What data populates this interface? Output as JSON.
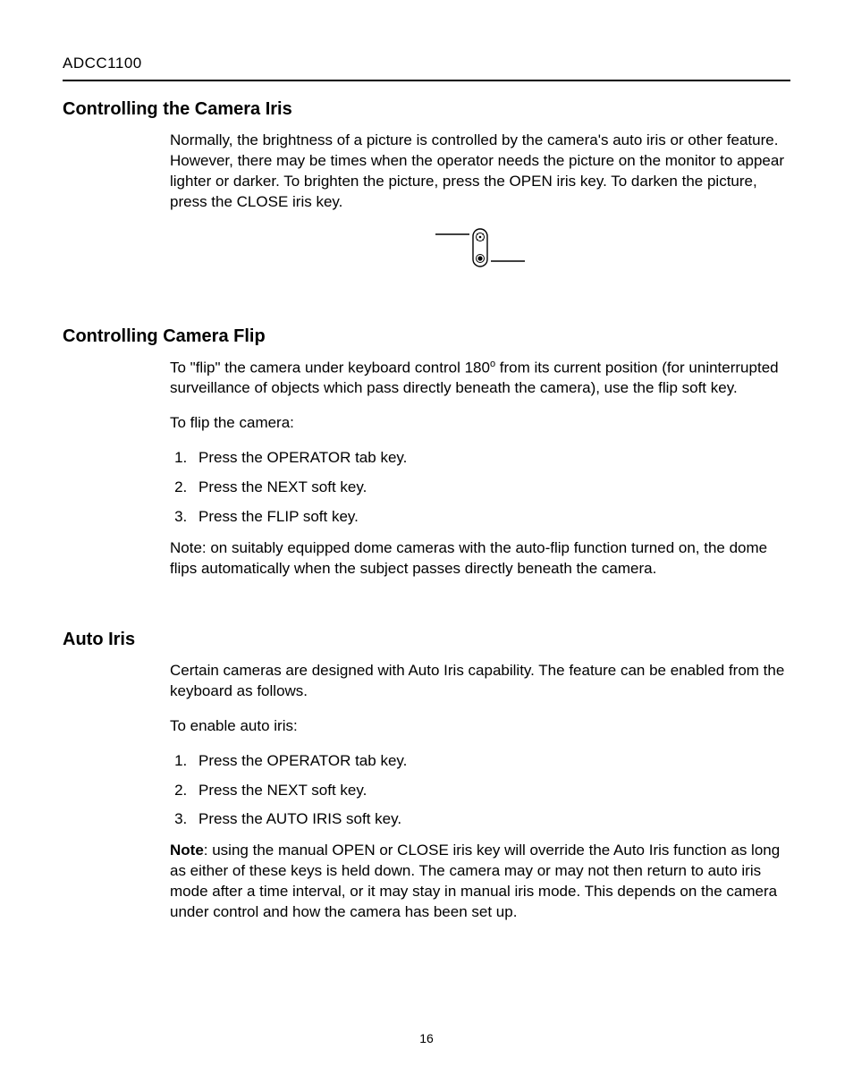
{
  "header": "ADCC1100",
  "page_number": "16",
  "section1": {
    "title": "Controlling the Camera Iris",
    "para": "Normally, the brightness of a picture is controlled by the camera's auto iris or other feature. However, there may be times when the operator needs the picture on the monitor to appear lighter or darker. To brighten the picture, press the OPEN iris key. To darken the picture, press the CLOSE iris key."
  },
  "section2": {
    "title": "Controlling Camera Flip",
    "para_pre": "To \"flip\" the camera under keyboard control 180",
    "para_sup": "o",
    "para_post": " from its current position (for uninterrupted surveillance of objects which pass directly beneath the camera), use the flip soft key.",
    "lead": "To flip the camera:",
    "steps": [
      "Press the OPERATOR tab key.",
      "Press the NEXT soft key.",
      "Press the FLIP soft key."
    ],
    "note": "Note: on suitably equipped dome cameras with the auto-flip function turned on, the dome flips automatically when the subject passes directly beneath the camera."
  },
  "section3": {
    "title": "Auto Iris",
    "para": "Certain cameras are designed with Auto Iris capability. The feature can be enabled from the keyboard as follows.",
    "lead": "To enable auto iris:",
    "steps": [
      "Press the OPERATOR tab key.",
      "Press the NEXT soft key.",
      "Press the AUTO IRIS soft key."
    ],
    "note_label": "Note",
    "note_body": ": using the manual OPEN or CLOSE iris key will override the Auto Iris function as long as either of these keys is held down. The camera may or may not then return to auto iris mode after a time interval, or it may stay in manual iris mode. This depends on the camera under control and how the camera has been set up."
  }
}
